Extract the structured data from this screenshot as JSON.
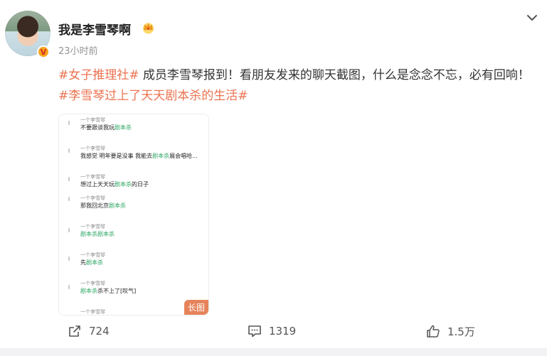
{
  "user": {
    "name": "我是李雪琴啊",
    "time": "23小时前"
  },
  "post": {
    "hashtag1": "#女子推理社#",
    "text1": " 成员李雪琴报到！看朋友发来的聊天截图，什么是念念不忘，必有回响！",
    "hashtag2": "#李雪琴过上了天天剧本杀的生活#"
  },
  "long_image": {
    "tag": "长图",
    "messages": [
      {
        "sender": "一个李雪琴",
        "before": "不要跟谈我玩",
        "highlight": "剧本杀",
        "after": ""
      },
      {
        "sender": "一个李雪琴",
        "before": "我感觉 明年要是没事 我能去",
        "highlight": "剧本杀",
        "after": "展会唱哈..."
      },
      {
        "sender": "一个李雪琴",
        "before": "想过上天天玩",
        "highlight": "剧本杀",
        "after": "的日子"
      },
      {
        "sender": "一个李雪琴",
        "before": "那我回北京",
        "highlight": "剧本杀",
        "after": ""
      },
      {
        "sender": "一个李雪琴",
        "before": "",
        "highlight": "剧本杀剧本杀",
        "after": ""
      },
      {
        "sender": "一个李雪琴",
        "before": "先",
        "highlight": "剧本杀",
        "after": ""
      },
      {
        "sender": "一个李雪琴",
        "before": "",
        "highlight": "剧本杀",
        "after": "杀不上了[叹气]"
      },
      {
        "sender": "一个李雪琴",
        "before": "",
        "highlight": "",
        "after": ""
      }
    ]
  },
  "actions": {
    "repost_count": "724",
    "comment_count": "1319",
    "like_count": "1.5万"
  },
  "colors": {
    "hashtag": "#eb7350",
    "badge": "#f7a31b",
    "chat_highlight": "#27a35f"
  }
}
